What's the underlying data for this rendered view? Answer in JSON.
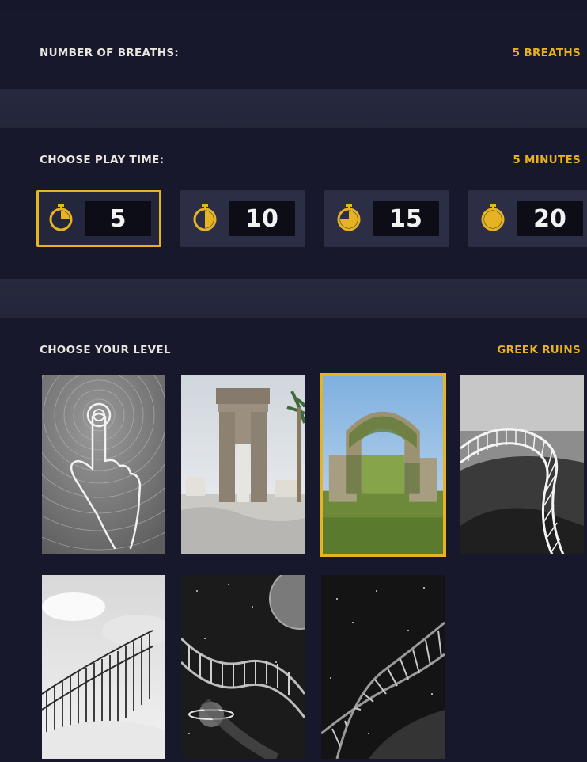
{
  "breaths": {
    "label": "NUMBER OF BREATHS:",
    "value": "5 BREATHS"
  },
  "play_time": {
    "label": "CHOOSE PLAY TIME:",
    "value": "5 MINUTES",
    "options": [
      {
        "minutes": "5",
        "selected": true
      },
      {
        "minutes": "10",
        "selected": false
      },
      {
        "minutes": "15",
        "selected": false
      },
      {
        "minutes": "20",
        "selected": false
      }
    ]
  },
  "level": {
    "label": "CHOOSE YOUR LEVEL",
    "value": "GREEK RUINS"
  },
  "colors": {
    "accent": "#e6b423",
    "background": "#17182b",
    "tile": "#2b2e44"
  },
  "icons": [
    "stopwatch-icon"
  ]
}
